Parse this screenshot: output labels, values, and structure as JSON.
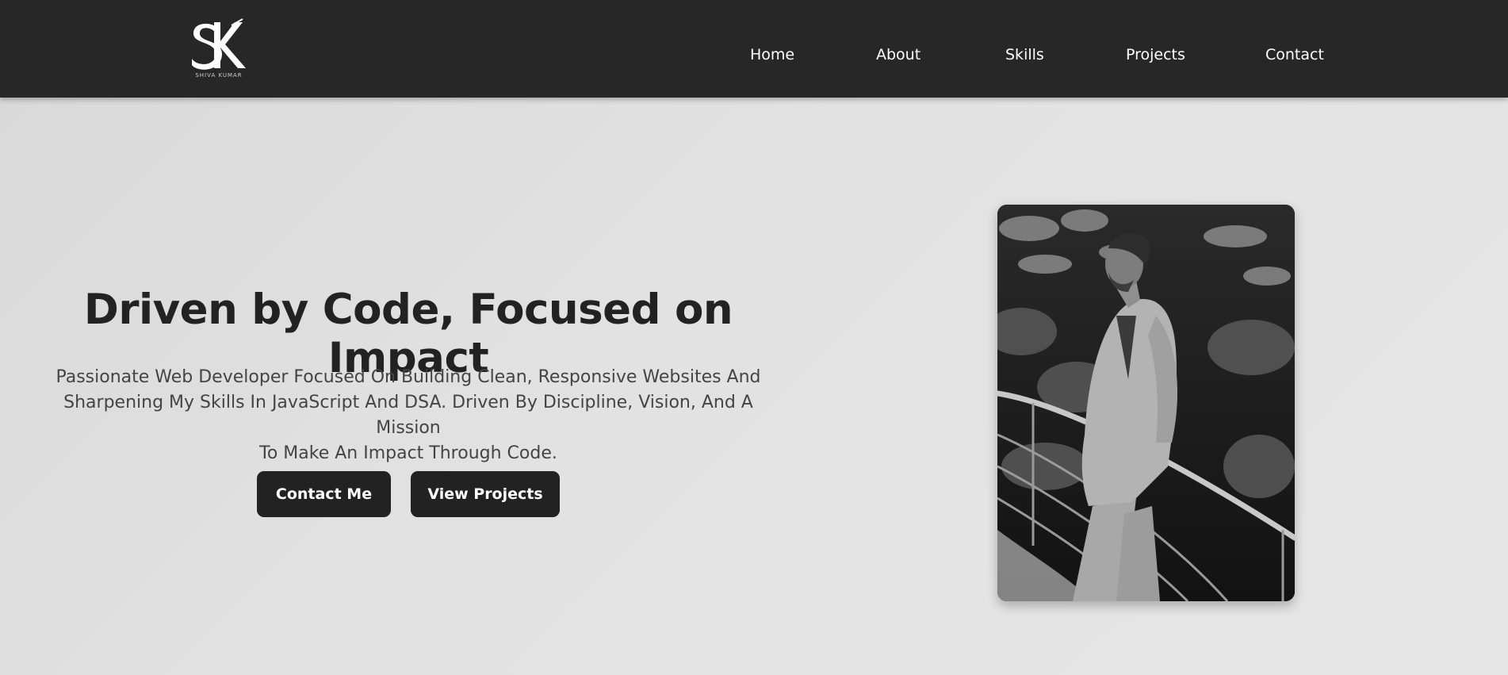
{
  "header": {
    "logo": {
      "monogram": "SK",
      "wordmark": "SHIVA KUMAR"
    },
    "nav": {
      "items": [
        {
          "label": "Home"
        },
        {
          "label": "About"
        },
        {
          "label": "Skills"
        },
        {
          "label": "Projects"
        },
        {
          "label": "Contact"
        }
      ]
    }
  },
  "hero": {
    "title": "Driven by Code, Focused on Impact",
    "description_lines": [
      "Passionate Web Developer Focused On Building Clean, Responsive Websites And",
      "Sharpening My Skills In JavaScript And DSA. Driven By Discipline, Vision, And A Mission",
      "To Make An Impact Through Code."
    ],
    "buttons": {
      "contact_label": "Contact Me",
      "projects_label": "View Projects"
    },
    "photo": {
      "subject": "profile-photo"
    }
  },
  "colors": {
    "navbar_bg": "#272727",
    "button_bg": "#222222",
    "title_text": "#222222",
    "body_text": "#444444"
  }
}
